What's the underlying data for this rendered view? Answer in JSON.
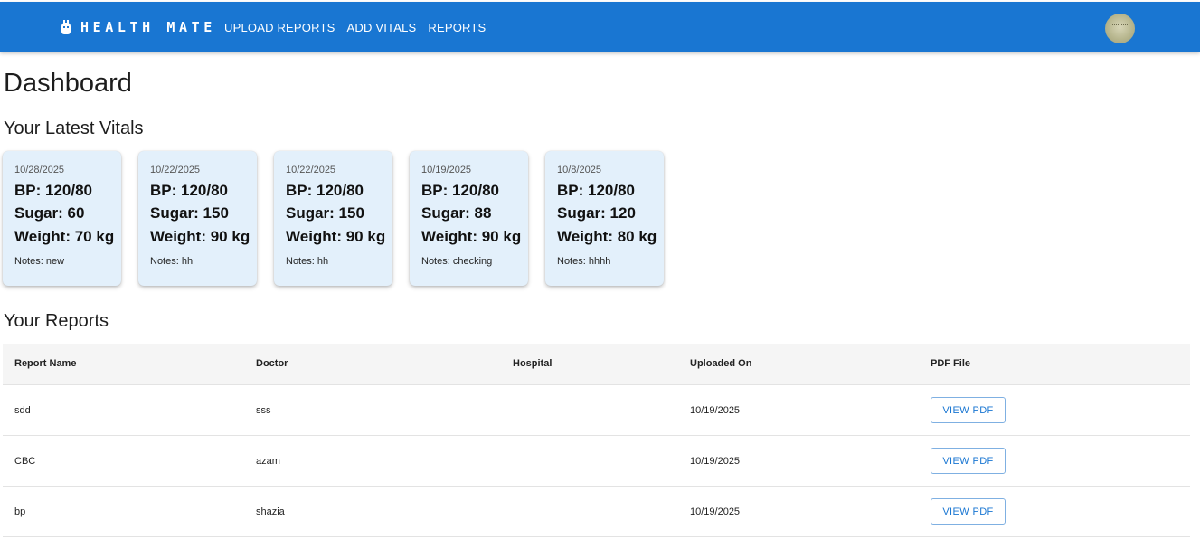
{
  "header": {
    "brand": "HEALTH MATE",
    "nav": [
      "UPLOAD REPORTS",
      "ADD VITALS",
      "REPORTS"
    ]
  },
  "page": {
    "title": "Dashboard",
    "vitals_heading": "Your Latest Vitals",
    "reports_heading": "Your Reports"
  },
  "vitals": [
    {
      "date": "10/28/2025",
      "bp": "BP: 120/80",
      "sugar": "Sugar: 60",
      "weight": "Weight: 70 kg",
      "notes": "Notes: new"
    },
    {
      "date": "10/22/2025",
      "bp": "BP: 120/80",
      "sugar": "Sugar: 150",
      "weight": "Weight: 90 kg",
      "notes": "Notes: hh"
    },
    {
      "date": "10/22/2025",
      "bp": "BP: 120/80",
      "sugar": "Sugar: 150",
      "weight": "Weight: 90 kg",
      "notes": "Notes: hh"
    },
    {
      "date": "10/19/2025",
      "bp": "BP: 120/80",
      "sugar": "Sugar: 88",
      "weight": "Weight: 90 kg",
      "notes": "Notes: checking"
    },
    {
      "date": "10/8/2025",
      "bp": "BP: 120/80",
      "sugar": "Sugar: 120",
      "weight": "Weight: 80 kg",
      "notes": "Notes: hhhh"
    }
  ],
  "reports": {
    "columns": [
      "Report Name",
      "Doctor",
      "Hospital",
      "Uploaded On",
      "PDF File"
    ],
    "button_label": "VIEW PDF",
    "rows": [
      {
        "name": "sdd",
        "doctor": "sss",
        "hospital": "",
        "uploaded": "10/19/2025"
      },
      {
        "name": "CBC",
        "doctor": "azam",
        "hospital": "",
        "uploaded": "10/19/2025"
      },
      {
        "name": "bp",
        "doctor": "shazia",
        "hospital": "",
        "uploaded": "10/19/2025"
      }
    ]
  },
  "colors": {
    "appbar": "#1976d2",
    "card_bg": "#e3f0fb",
    "table_header_bg": "#f5f5f5"
  }
}
